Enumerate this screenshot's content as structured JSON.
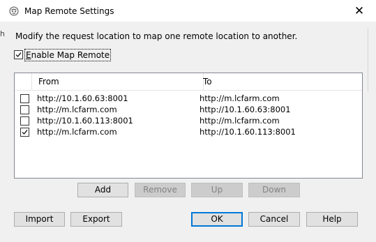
{
  "window": {
    "title": "Map Remote Settings",
    "close_glyph": "✕",
    "edge_fragment": "h"
  },
  "description": "Modify the request location to map one remote location to another.",
  "enable": {
    "accel": "E",
    "rest": "nable Map Remote",
    "checked": true
  },
  "table": {
    "headers": {
      "from": "From",
      "to": "To"
    },
    "rows": [
      {
        "checked": false,
        "from": "http://10.1.60.63:8001",
        "to": "http://m.lcfarm.com"
      },
      {
        "checked": false,
        "from": "http://m.lcfarm.com",
        "to": "http://10.1.60.63:8001"
      },
      {
        "checked": false,
        "from": "http://10.1.60.113:8001",
        "to": "http://m.lcfarm.com"
      },
      {
        "checked": true,
        "from": "http://m.lcfarm.com",
        "to": "http://10.1.60.113:8001"
      }
    ]
  },
  "list_buttons": {
    "add": "Add",
    "remove": "Remove",
    "up": "Up",
    "down": "Down"
  },
  "footer_buttons": {
    "import": "Import",
    "export": "Export",
    "ok": "OK",
    "cancel": "Cancel",
    "help": "Help"
  },
  "icons": {
    "app": "charles-app-icon",
    "close": "close-icon",
    "checkbox_check": "checkmark-icon"
  },
  "colors": {
    "default_button_border": "#0078d7",
    "dialog_bg": "#f0f0f0",
    "disabled_button_bg": "#cccccc"
  }
}
